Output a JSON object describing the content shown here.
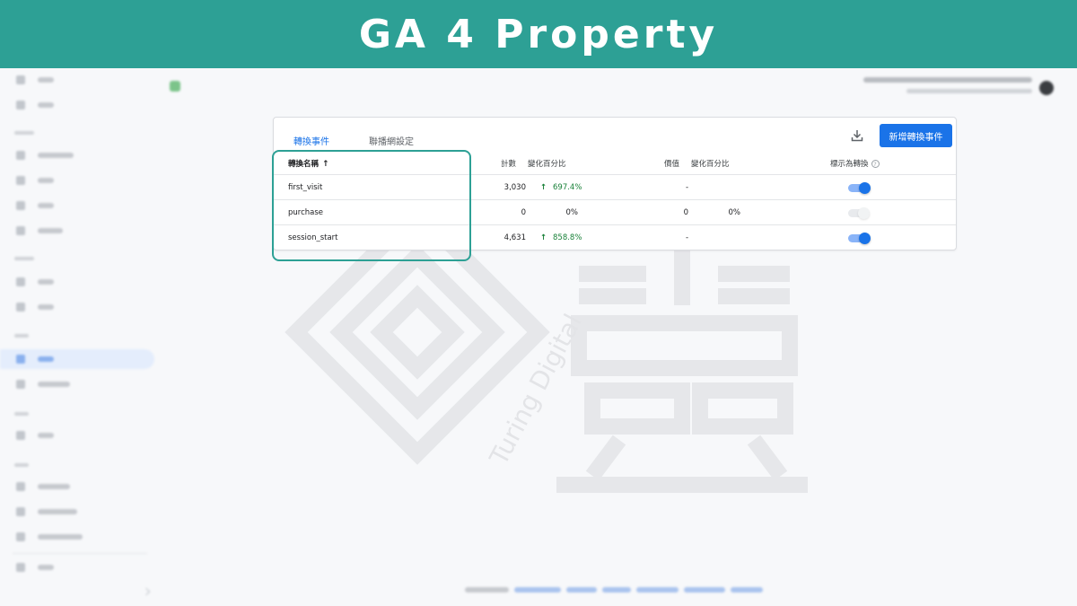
{
  "banner": {
    "title": "GA 4 Property"
  },
  "card": {
    "tabs": [
      {
        "label": "轉換事件",
        "active": true
      },
      {
        "label": "聯播網設定",
        "active": false
      }
    ],
    "download_icon": "download-icon",
    "add_button_label": "新增轉換事件",
    "table": {
      "headers": {
        "name": "轉換名稱",
        "count": "計數",
        "count_change": "變化百分比",
        "value": "價值",
        "value_change": "變化百分比",
        "mark_as_conversion": "標示為轉換"
      },
      "sort_indicator": "↑",
      "help_glyph": "?",
      "rows": [
        {
          "name": "first_visit",
          "count": "3,030",
          "count_change": "697.4%",
          "count_trend": "up",
          "value": "-",
          "value_change": "",
          "conversion": true
        },
        {
          "name": "purchase",
          "count": "0",
          "count_change": "0%",
          "count_trend": "none",
          "value": "0",
          "value_change": "0%",
          "conversion": false
        },
        {
          "name": "session_start",
          "count": "4,631",
          "count_change": "858.8%",
          "count_trend": "up",
          "value": "-",
          "value_change": "",
          "conversion": true
        }
      ]
    }
  },
  "watermark": {
    "text": "Turing Digital"
  },
  "colors": {
    "banner": "#2da095",
    "highlight_border": "#2da095",
    "primary": "#1a73e8",
    "positive": "#188038"
  }
}
